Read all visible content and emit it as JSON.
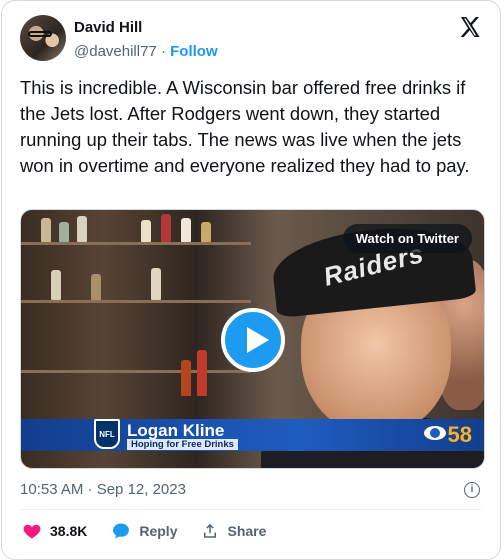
{
  "author": {
    "name": "David Hill",
    "handle": "@davehill77",
    "separator": "·",
    "follow_label": "Follow"
  },
  "tweet": {
    "text": "This is incredible. A Wisconsin bar offered free drinks if the Jets lost. After Rodgers went down, they started running up their tabs. The news was live when the jets won in overtime and everyone realized they had to pay."
  },
  "media": {
    "watch_label": "Watch on Twitter",
    "cap_text": "Raiders",
    "lower_third_name": "Logan Kline",
    "lower_third_subtitle": "Hoping for Free Drinks",
    "nfl_text": "NFL",
    "station_number": "58"
  },
  "meta": {
    "timestamp": "10:53 AM · Sep 12, 2023"
  },
  "actions": {
    "likes": "38.8K",
    "reply_label": "Reply",
    "share_label": "Share"
  },
  "colors": {
    "accent": "#1d9bf0",
    "like": "#f91880",
    "muted": "#536471"
  },
  "icons": [
    "x-logo-icon",
    "info-icon",
    "heart-icon",
    "reply-icon",
    "share-icon",
    "play-icon"
  ]
}
